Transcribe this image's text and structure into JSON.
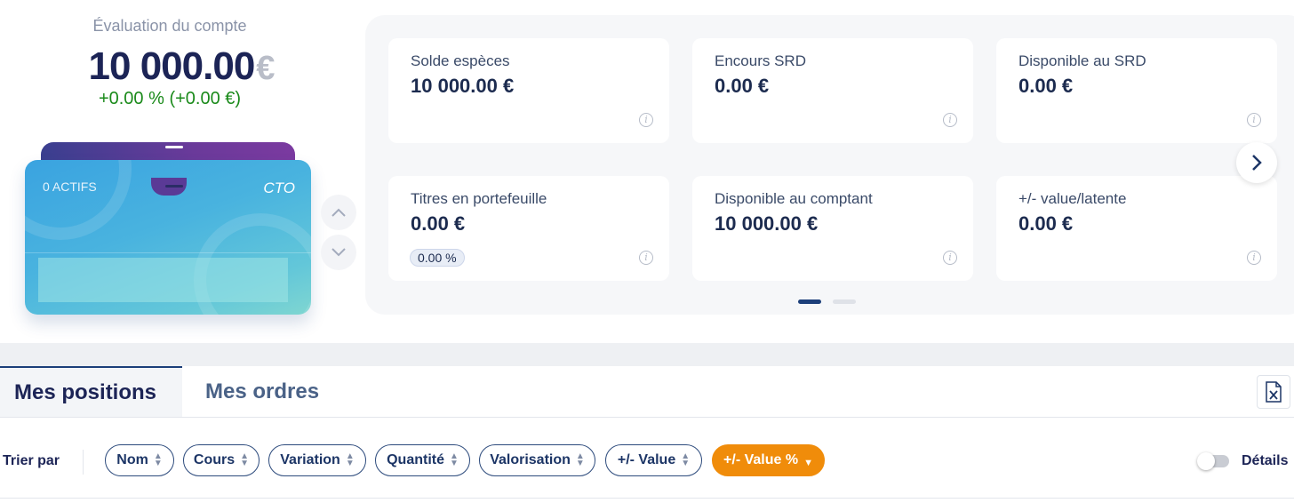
{
  "account": {
    "label": "Évaluation du compte",
    "value": "10 000.00",
    "currency": "€",
    "variation": "+0.00 % (+0.00 €)"
  },
  "wallet": {
    "assets_label": "0 ACTIFS",
    "account_type": "CTO"
  },
  "cards": [
    {
      "label": "Solde espèces",
      "value": "10 000.00 €"
    },
    {
      "label": "Encours SRD",
      "value": "0.00 €"
    },
    {
      "label": "Disponible au SRD",
      "value": "0.00 €"
    },
    {
      "label": "Titres en portefeuille",
      "value": "0.00 €",
      "badge": "0.00 %"
    },
    {
      "label": "Disponible au comptant",
      "value": "10 000.00 €"
    },
    {
      "label": "+/- value/latente",
      "value": "0.00 €"
    }
  ],
  "info_glyph": "i",
  "tabs": [
    {
      "label": "Mes positions",
      "active": true
    },
    {
      "label": "Mes ordres",
      "active": false
    }
  ],
  "sort": {
    "label": "Trier par",
    "options": [
      "Nom",
      "Cours",
      "Variation",
      "Quantité",
      "Valorisation",
      "+/- Value",
      "+/- Value %"
    ],
    "active_option": "+/- Value %"
  },
  "details_toggle": {
    "label": "Détails",
    "on": false
  },
  "colors": {
    "accent_orange": "#f08c0a",
    "navy": "#1c2456",
    "positive_green": "#1a8a1a"
  },
  "icons": [
    "chevron-up-icon",
    "chevron-down-icon",
    "chevron-right-icon",
    "info-icon",
    "excel-export-icon",
    "sort-icon",
    "sort-desc-icon"
  ]
}
